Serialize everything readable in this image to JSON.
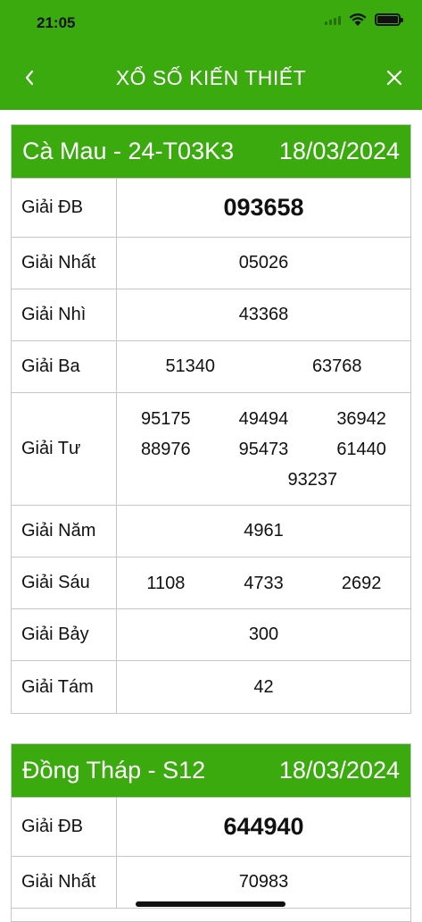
{
  "status": {
    "time": "21:05"
  },
  "nav": {
    "title": "XỔ SỐ KIẾN THIẾT",
    "back_icon": "chevron-left-icon",
    "close_icon": "close-icon"
  },
  "colors": {
    "brand_green": "#3aaa0e",
    "border": "#c7c7c7"
  },
  "results": [
    {
      "province": "Cà Mau - 24-T03K3",
      "date": "18/03/2024",
      "prizes": [
        {
          "label": "Giải ĐB",
          "numbers": [
            "093658"
          ]
        },
        {
          "label": "Giải Nhất",
          "numbers": [
            "05026"
          ]
        },
        {
          "label": "Giải Nhì",
          "numbers": [
            "43368"
          ]
        },
        {
          "label": "Giải Ba",
          "numbers": [
            "51340",
            "63768"
          ]
        },
        {
          "label": "Giải Tư",
          "numbers": [
            "95175",
            "49494",
            "36942",
            "88976",
            "95473",
            "61440",
            "93237"
          ]
        },
        {
          "label": "Giải Năm",
          "numbers": [
            "4961"
          ]
        },
        {
          "label": "Giải Sáu",
          "numbers": [
            "1108",
            "4733",
            "2692"
          ]
        },
        {
          "label": "Giải Bảy",
          "numbers": [
            "300"
          ]
        },
        {
          "label": "Giải Tám",
          "numbers": [
            "42"
          ]
        }
      ]
    },
    {
      "province": "Đồng Tháp - S12",
      "date": "18/03/2024",
      "prizes": [
        {
          "label": "Giải ĐB",
          "numbers": [
            "644940"
          ]
        },
        {
          "label": "Giải Nhất",
          "numbers": [
            "70983"
          ]
        }
      ]
    }
  ]
}
